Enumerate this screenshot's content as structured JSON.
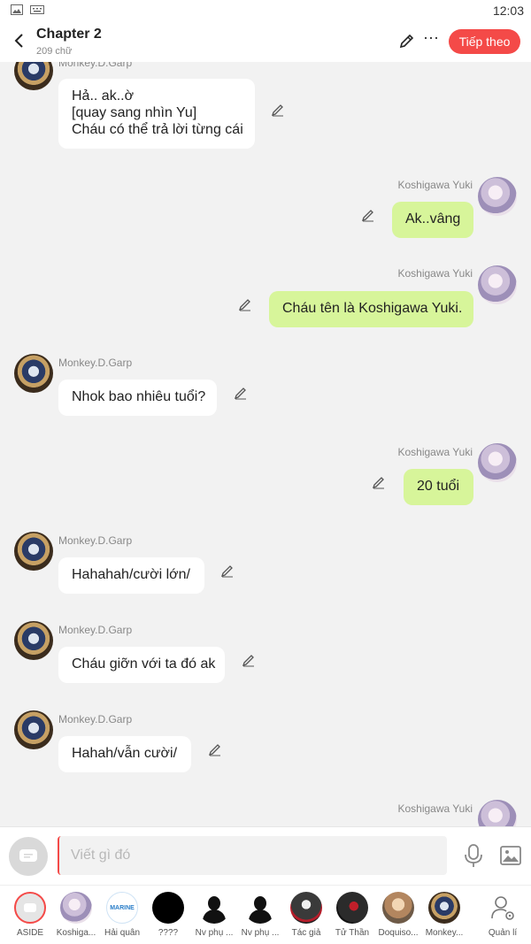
{
  "status_bar": {
    "time": "12:03"
  },
  "header": {
    "title": "Chapter 2",
    "word_count": "209 chữ",
    "next_label": "Tiếp theo",
    "next_color": "#f44a48"
  },
  "messages": [
    {
      "side": "left",
      "speaker": "Monkey.D.Garp",
      "text": [
        "Hả.. ak..ờ",
        "[quay sang nhìn Yu]",
        "Cháu có thể trả lời từng cái"
      ],
      "icon": "garp-avatar"
    },
    {
      "side": "right",
      "speaker": "Koshigawa Yuki",
      "text": [
        "Ak..vâng"
      ],
      "icon": "yuki-avatar"
    },
    {
      "side": "right",
      "speaker": "Koshigawa Yuki",
      "text": [
        "Cháu tên là Koshigawa Yuki."
      ],
      "icon": "yuki-avatar"
    },
    {
      "side": "left",
      "speaker": "Monkey.D.Garp",
      "text": [
        "Nhok bao nhiêu tuổi?"
      ],
      "icon": "garp-avatar"
    },
    {
      "side": "right",
      "speaker": "Koshigawa Yuki",
      "text": [
        "20 tuổi"
      ],
      "icon": "yuki-avatar"
    },
    {
      "side": "left",
      "speaker": "Monkey.D.Garp",
      "text": [
        "Hahahah/cười lớn/"
      ],
      "icon": "garp-avatar"
    },
    {
      "side": "left",
      "speaker": "Monkey.D.Garp",
      "text": [
        "Cháu giỡn với ta đó ak"
      ],
      "icon": "garp-avatar"
    },
    {
      "side": "left",
      "speaker": "Monkey.D.Garp",
      "text": [
        "Hahah/vẫn cười/"
      ],
      "icon": "garp-avatar"
    },
    {
      "side": "right",
      "speaker": "Koshigawa Yuki",
      "text": [],
      "icon": "yuki-avatar"
    }
  ],
  "input": {
    "placeholder": "Viết gì đó"
  },
  "characters": [
    {
      "label": "ASIDE",
      "icon": "aside-icon"
    },
    {
      "label": "Koshiga...",
      "icon": "yuki-avatar"
    },
    {
      "label": "Hải quân",
      "icon": "marine-logo",
      "logo_text": "MARINE"
    },
    {
      "label": "????",
      "icon": "black-avatar"
    },
    {
      "label": "Nv phụ ...",
      "icon": "silhouette-avatar"
    },
    {
      "label": "Nv phụ ...",
      "icon": "silhouette-avatar"
    },
    {
      "label": "Tác giả",
      "icon": "author-avatar"
    },
    {
      "label": "Tử Thần",
      "icon": "death-avatar"
    },
    {
      "label": "Doquiso...",
      "icon": "doquiso-avatar"
    },
    {
      "label": "Monkey...",
      "icon": "garp-avatar"
    },
    {
      "label": "Quản lí",
      "icon": "admin-icon"
    }
  ]
}
